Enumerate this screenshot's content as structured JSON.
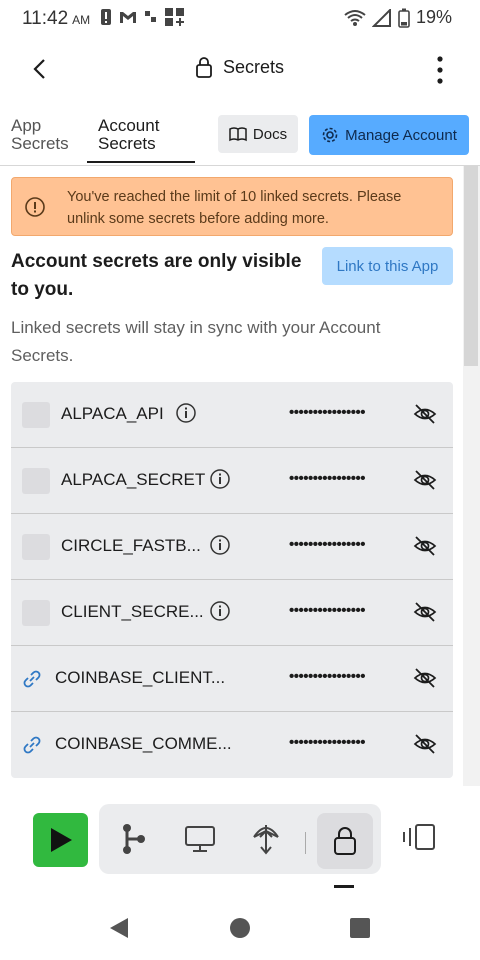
{
  "status_bar": {
    "time": "11:42",
    "ampm": "AM",
    "battery": "19%"
  },
  "header": {
    "title": "Secrets"
  },
  "tabs": {
    "app_line1": "App",
    "app_line2": "Secrets",
    "account_line1": "Account",
    "account_line2": "Secrets"
  },
  "buttons": {
    "docs": "Docs",
    "manage_account": "Manage Account",
    "link_to_app": "Link to this App"
  },
  "warning": {
    "text": "You've reached the limit of 10 linked secrets. Please unlink some secrets before adding more."
  },
  "heading": "Account secrets are only visible to you.",
  "subtext": "Linked secrets will stay in sync with your Account Secrets.",
  "secrets": [
    {
      "name": "ALPACA_API",
      "value": "••••••••••••••••",
      "linked": false
    },
    {
      "name": "ALPACA_SECRET",
      "value": "••••••••••••••••",
      "linked": false
    },
    {
      "name": "CIRCLE_FASTB...",
      "value": "••••••••••••••••",
      "linked": false
    },
    {
      "name": "CLIENT_SECRE...",
      "value": "••••••••••••••••",
      "linked": false
    },
    {
      "name": "COINBASE_CLIENT...",
      "value": "••••••••••••••••",
      "linked": true
    },
    {
      "name": "COINBASE_COMME...",
      "value": "••••••••••••••••",
      "linked": true
    }
  ],
  "colors": {
    "accent": "#57abff",
    "warning_bg": "#ffc293",
    "run_green": "#31b93f",
    "link_blue": "#2f78c4"
  },
  "icons": [
    "back-arrow-icon",
    "lock-icon",
    "more-vertical-icon",
    "book-icon",
    "gear-icon",
    "info-icon",
    "eye-off-icon",
    "link-icon",
    "play-icon",
    "workflow-icon",
    "monitor-icon",
    "deploy-icon",
    "split-view-icon"
  ]
}
